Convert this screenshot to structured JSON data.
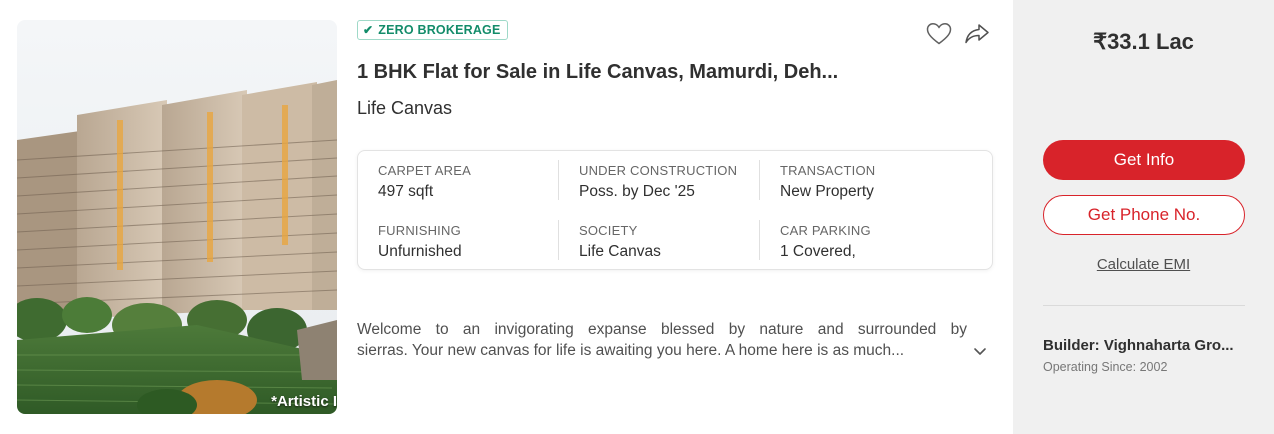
{
  "badge": {
    "label": "ZERO BROKERAGE",
    "icon": "check-icon",
    "color": "#138c6a"
  },
  "listing": {
    "title": "1 BHK Flat for Sale in Life Canvas, Mamurdi, Deh...",
    "subtitle": "Life Canvas",
    "image_caption": "*Artistic I"
  },
  "actions": {
    "shortlist_icon": "heart-icon",
    "share_icon": "share-icon"
  },
  "summary": [
    {
      "label": "CARPET AREA",
      "value": "497 sqft"
    },
    {
      "label": "UNDER CONSTRUCTION",
      "value": "Poss. by Dec '25"
    },
    {
      "label": "TRANSACTION",
      "value": "New Property"
    },
    {
      "label": "FURNISHING",
      "value": "Unfurnished"
    },
    {
      "label": "SOCIETY",
      "value": "Life Canvas"
    },
    {
      "label": "CAR PARKING",
      "value": "1 Covered,"
    }
  ],
  "description": {
    "line1": "Welcome to an invigorating expanse blessed by nature and surrounded by",
    "line2": "sierras. Your new canvas for life is awaiting you here. A home here is as much...",
    "expand_icon": "chevron-down-icon"
  },
  "side": {
    "price": "₹33.1 Lac",
    "get_info": "Get Info",
    "get_phone": "Get Phone No.",
    "emi": "Calculate EMI",
    "builder": "Builder: Vighnaharta Gro...",
    "operating_since": "Operating Since: 2002"
  },
  "colors": {
    "brand_red": "#d8232a",
    "panel_bg": "#f0f0f0",
    "badge_green": "#138c6a"
  }
}
